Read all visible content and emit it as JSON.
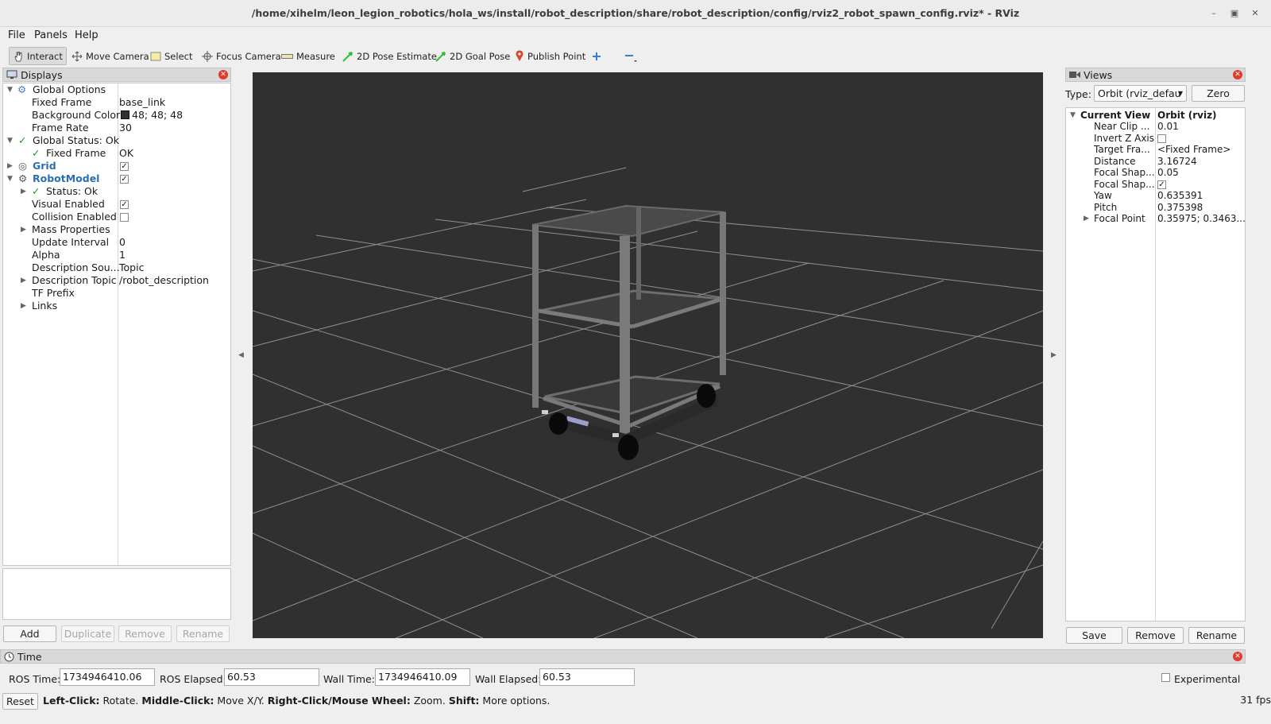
{
  "window": {
    "title": "/home/xihelm/leon_legion_robotics/hola_ws/install/robot_description/share/robot_description/config/rviz2_robot_spawn_config.rviz* - RViz"
  },
  "menu": {
    "file": "File",
    "panels": "Panels",
    "help": "Help"
  },
  "toolbar": {
    "interact": "Interact",
    "move_camera": "Move Camera",
    "select": "Select",
    "focus_camera": "Focus Camera",
    "measure": "Measure",
    "pose_estimate": "2D Pose Estimate",
    "goal_pose": "2D Goal Pose",
    "publish_point": "Publish Point"
  },
  "displays": {
    "title": "Displays",
    "rows": {
      "global_options": "Global Options",
      "fixed_frame": {
        "k": "Fixed Frame",
        "v": "base_link"
      },
      "background_color": {
        "k": "Background Color",
        "v": "48; 48; 48",
        "swatch": "#303030"
      },
      "frame_rate": {
        "k": "Frame Rate",
        "v": "30"
      },
      "global_status": "Global Status: Ok",
      "status_fixed_frame": {
        "k": "Fixed Frame",
        "v": "OK"
      },
      "grid": "Grid",
      "robot_model": "RobotModel",
      "rm_status": "Status: Ok",
      "visual_enabled": "Visual Enabled",
      "collision_enabled": "Collision Enabled",
      "mass_properties": "Mass Properties",
      "update_interval": {
        "k": "Update Interval",
        "v": "0"
      },
      "alpha": {
        "k": "Alpha",
        "v": "1"
      },
      "description_source": {
        "k": "Description Sou...",
        "v": "Topic"
      },
      "description_topic": {
        "k": "Description Topic",
        "v": "/robot_description"
      },
      "tf_prefix": "TF Prefix",
      "links": "Links"
    },
    "buttons": {
      "add": "Add",
      "duplicate": "Duplicate",
      "remove": "Remove",
      "rename": "Rename"
    }
  },
  "views": {
    "title": "Views",
    "type_label": "Type:",
    "type_value": "Orbit (rviz_defau",
    "zero": "Zero",
    "rows": {
      "current_view": {
        "k": "Current View",
        "v": "Orbit (rviz)"
      },
      "near_clip": {
        "k": "Near Clip ...",
        "v": "0.01"
      },
      "invert_z": {
        "k": "Invert Z Axis"
      },
      "target_frame": {
        "k": "Target Fra...",
        "v": "<Fixed Frame>"
      },
      "distance": {
        "k": "Distance",
        "v": "3.16724"
      },
      "focal_shape_size": {
        "k": "Focal Shap...",
        "v": "0.05"
      },
      "focal_shape_fixed": {
        "k": "Focal Shap..."
      },
      "yaw": {
        "k": "Yaw",
        "v": "0.635391"
      },
      "pitch": {
        "k": "Pitch",
        "v": "0.375398"
      },
      "focal_point": {
        "k": "Focal Point",
        "v": "0.35975; 0.3463..."
      }
    },
    "buttons": {
      "save": "Save",
      "remove": "Remove",
      "rename": "Rename"
    }
  },
  "time": {
    "title": "Time",
    "ros_time_label": "ROS Time:",
    "ros_time": "1734946410.06",
    "ros_elapsed_label": "ROS Elapsed:",
    "ros_elapsed": "60.53",
    "wall_time_label": "Wall Time:",
    "wall_time": "1734946410.09",
    "wall_elapsed_label": "Wall Elapsed:",
    "wall_elapsed": "60.53",
    "experimental": "Experimental"
  },
  "status": {
    "reset": "Reset",
    "left_click": "Left-Click:",
    "left_click_desc": "Rotate.",
    "middle_click": "Middle-Click:",
    "middle_click_desc": "Move X/Y.",
    "right_click": "Right-Click/Mouse Wheel:",
    "right_click_desc": "Zoom.",
    "shift": "Shift:",
    "shift_desc": "More options.",
    "fps": "31 fps"
  }
}
